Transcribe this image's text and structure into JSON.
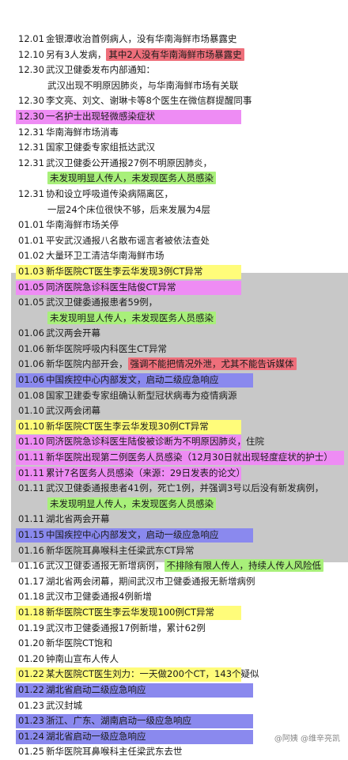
{
  "rows": [
    {
      "date": "12.01",
      "text": "金银潭收治首例病人，没有华南海鲜市场暴露史"
    },
    {
      "date": "12.10",
      "text": "另有3人发病，",
      "hl": "其中2人没有华南海鲜市场暴露史",
      "hlc": "r"
    },
    {
      "date": "12.30",
      "text": "武汉卫健委发布内部通知："
    },
    {
      "date": "",
      "text": "武汉出现不明原因肺炎，与华南海鲜市场有关联",
      "indent": true
    },
    {
      "date": "12.30",
      "text": "李文亮、刘文、谢琳卡等8个医生在微信群提醒同事"
    },
    {
      "date": "12.30",
      "text": "一名护士出现轻微感染症状",
      "row": "p"
    },
    {
      "date": "12.31",
      "text": "华南海鲜市场消毒"
    },
    {
      "date": "12.31",
      "text": "国家卫健委专家组抵达武汉"
    },
    {
      "date": "12.31",
      "text": "武汉卫健委公开通报27例不明原因肺炎，"
    },
    {
      "date": "",
      "text": "",
      "hl": "未发现明显人传人，未发现医务人员感染",
      "hlc": "g",
      "indent": true
    },
    {
      "date": "12.31",
      "text": "协和设立呼吸道传染病隔离区，"
    },
    {
      "date": "",
      "text": "一层24个床位很快不够，后来发展为4层",
      "indent": true
    },
    {
      "date": "01.01",
      "text": "华南海鲜市场关停"
    },
    {
      "date": "01.01",
      "text": "平安武汉通报八名散布谣言者被依法查处"
    },
    {
      "date": "01.02",
      "text": "大量环卫工清洁华南海鲜市场"
    },
    {
      "date": "01.03",
      "text": "新华医院CT医生李云华发现3例CT异常",
      "row": "y"
    },
    {
      "date": "01.05",
      "text": "同济医院急诊科医生陆俊CT异常",
      "row": "p"
    },
    {
      "date": "01.05",
      "text": "武汉卫健委通报患者59例，"
    },
    {
      "date": "",
      "text": "",
      "hl": "未发现明显人传人，未发现医务人员感染",
      "hlc": "g",
      "indent": true
    },
    {
      "date": "01.06",
      "text": "武汉两会开幕"
    },
    {
      "date": "01.06",
      "text": "新华医院呼吸内科医生CT异常"
    },
    {
      "date": "01.06",
      "text": "新华医院内部开会，",
      "hl": "强调不能把情况外泄，尤其不能告诉媒体",
      "hlc": "r"
    },
    {
      "date": "01.06",
      "text": "中国疾控中心内部发文，启动二级应急响应",
      "row": "b"
    },
    {
      "date": "01.08",
      "text": "国家卫建委专家组确认新型冠状病毒为疫情病源"
    },
    {
      "date": "01.10",
      "text": "武汉两会闭幕"
    },
    {
      "date": "01.10",
      "text": "新华医院CT医生李云华发现30例CT异常",
      "row": "y"
    },
    {
      "date": "01.10",
      "text": "同济医院急诊科医生陆俊被诊断为不明原因肺炎，住院",
      "row": "p"
    },
    {
      "date": "01.11",
      "text": "新华医院出现第二例医务人员感染（12月30日就出现轻度症状的护士）",
      "row": "p"
    },
    {
      "date": "01.11",
      "text": "累计7名医务人员感染（来源：29日发表的论文）",
      "row": "p"
    },
    {
      "date": "01.11",
      "text": "武汉卫健委通报患者41例，死亡1例，并强调3号以后没有新发病例，"
    },
    {
      "date": "",
      "text": "",
      "hl": "未发现明显人传人，未发现医务人员感染",
      "hlc": "g",
      "indent": true
    },
    {
      "date": "01.11",
      "text": "湖北省两会开幕"
    },
    {
      "date": "01.15",
      "text": "中国疾控中心内部发文，启动一级应急响应",
      "row": "b"
    },
    {
      "date": "01.16",
      "text": "新华医院耳鼻喉科主任梁武东CT异常"
    },
    {
      "date": "01.16",
      "text": "武汉卫健委通报无新增病例，",
      "hl": "不排除有限人传人，持续人传人风险低",
      "hlc": "g"
    },
    {
      "date": "01.17",
      "text": "湖北省两会闭幕，期间武汉市卫健委通报无新增病例"
    },
    {
      "date": "01.18",
      "text": "武汉市卫健委通报4例新增"
    },
    {
      "date": "01.18",
      "text": "新华医院CT医生李云华发现100例CT异常",
      "row": "y"
    },
    {
      "date": "01.19",
      "text": "武汉市卫健委通报17例新增，累计62例"
    },
    {
      "date": "01.20",
      "text": "新华医院CT饱和"
    },
    {
      "date": "01.20",
      "text": "钟南山宣布人传人"
    },
    {
      "date": "01.22",
      "text": "某大医院CT医生刘力：一天做200个CT，143个疑似",
      "row": "y"
    },
    {
      "date": "01.22",
      "text": "湖北省启动二级应急响应",
      "row": "b"
    },
    {
      "date": "01.23",
      "text": "武汉封城"
    },
    {
      "date": "01.23",
      "text": "浙江、广东、湖南启动一级应急响应",
      "row": "b"
    },
    {
      "date": "01.24",
      "text": "湖北省启动一级应急响应",
      "row": "b"
    },
    {
      "date": "01.25",
      "text": "新华医院耳鼻喉科主任梁武东去世"
    }
  ],
  "watermark": "@阿姨 @维辛亮凯"
}
